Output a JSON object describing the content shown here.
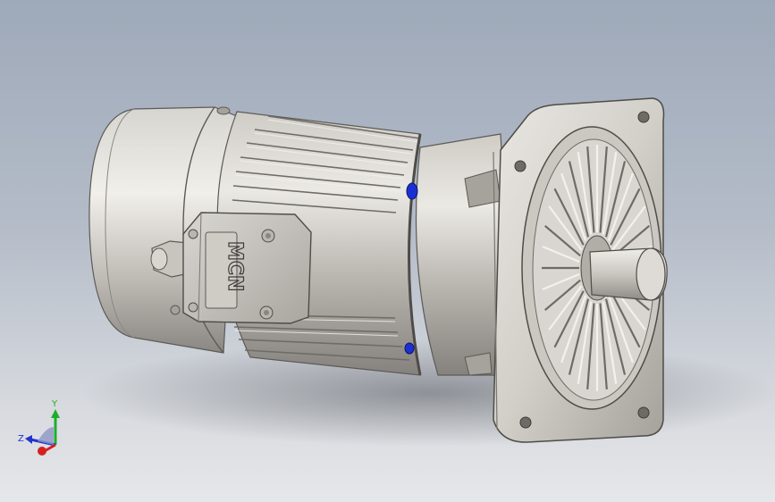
{
  "model": {
    "nameplate_text": "MCN"
  },
  "triad": {
    "x_label": "",
    "y_label": "Y",
    "z_label": "Z",
    "colors": {
      "x": "#d62020",
      "y": "#1fae2a",
      "z": "#2233cc"
    }
  },
  "colors": {
    "background_top": "#9ea9b9",
    "background_bottom": "#e6e7ea",
    "metal_light": "#e4e2dd",
    "metal_mid": "#bdbab4",
    "metal_dark": "#7e7b76",
    "seal_blue": "#1c2fd0"
  }
}
